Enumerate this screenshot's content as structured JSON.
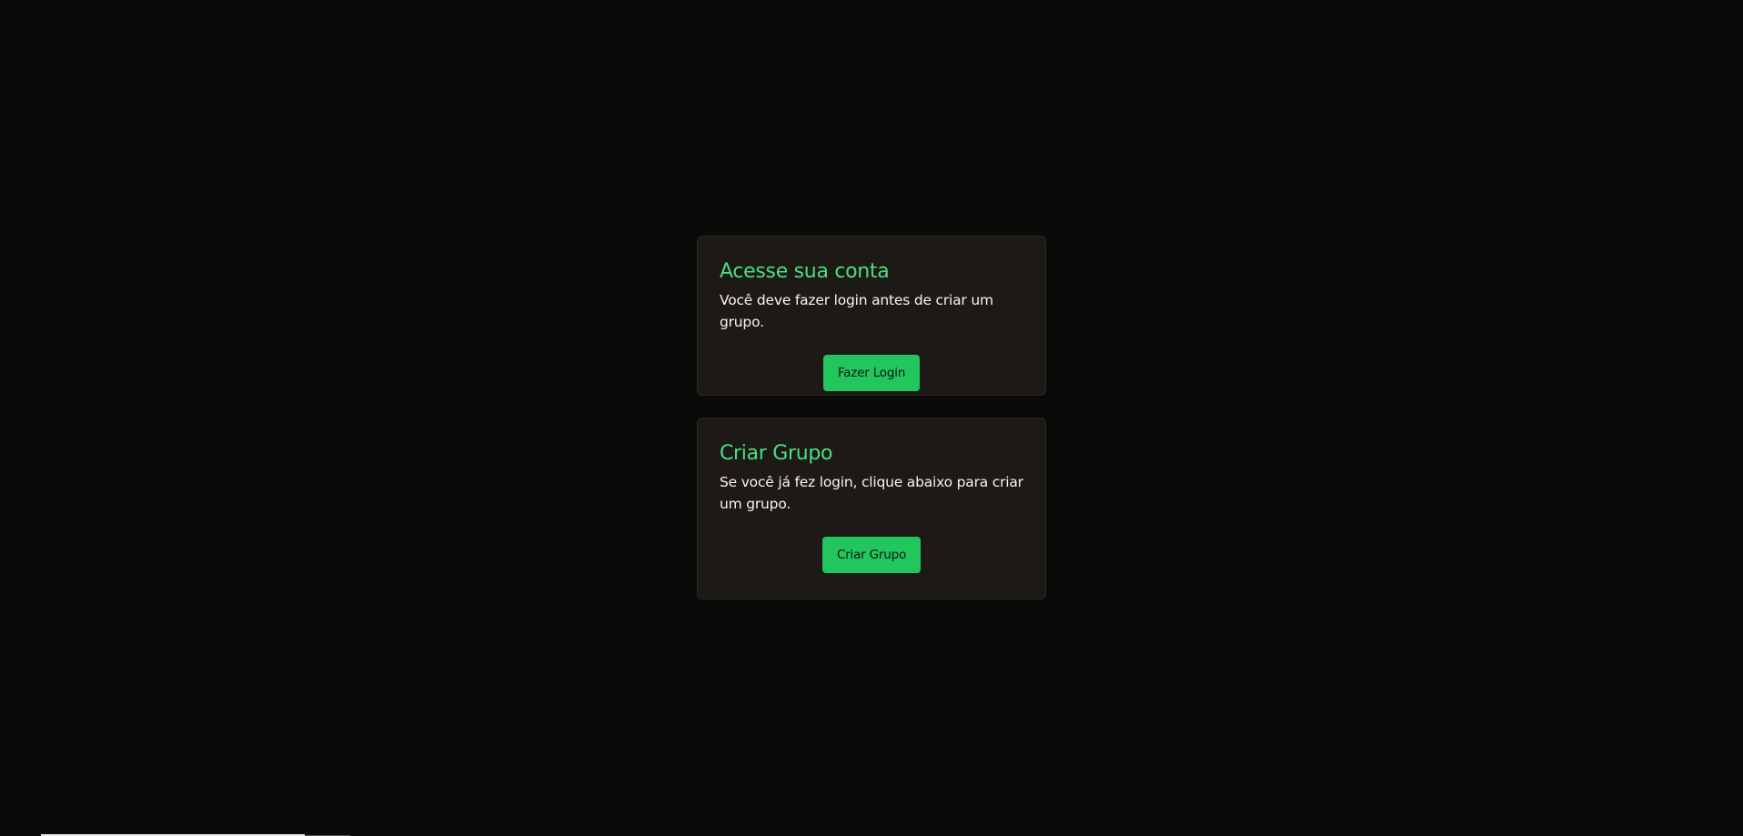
{
  "login_card": {
    "title": "Acesse sua conta",
    "description": "Você deve fazer login antes de criar um grupo.",
    "button_label": "Fazer Login"
  },
  "group_card": {
    "title": "Criar Grupo",
    "description": "Se você já fez login, clique abaixo para criar um grupo.",
    "button_label": "Criar Grupo"
  },
  "colors": {
    "background": "#0a0a09",
    "card": "#1c1917",
    "accent": "#4ade80",
    "button": "#22c55e"
  }
}
